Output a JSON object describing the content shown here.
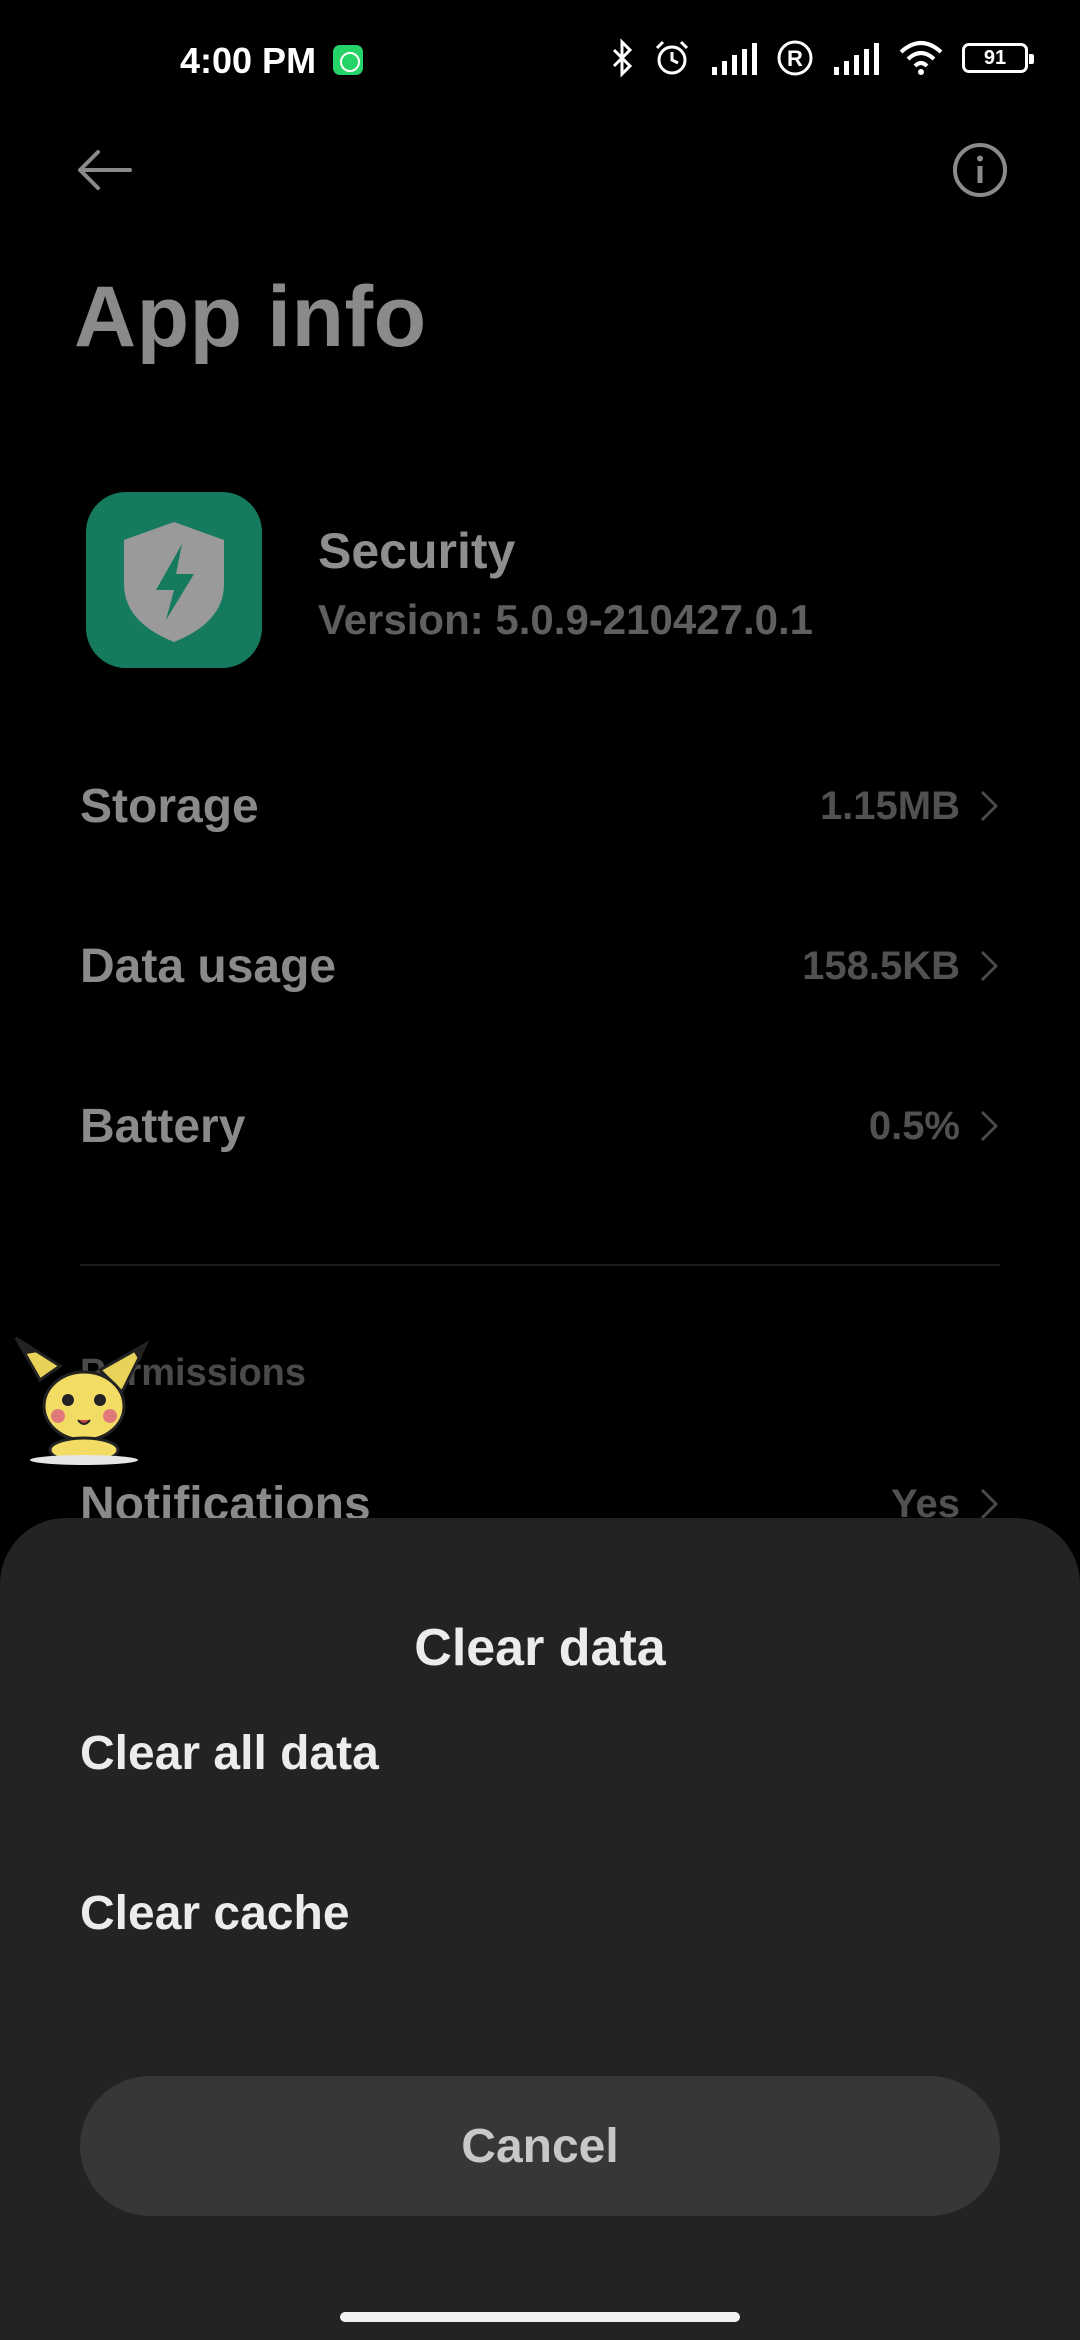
{
  "status_bar": {
    "time": "4:00 PM",
    "battery_level": "91",
    "icons": [
      "whatsapp-icon",
      "bluetooth-icon",
      "alarm-icon",
      "signal-icon",
      "roaming-icon",
      "signal-icon",
      "wifi-icon",
      "battery-icon"
    ]
  },
  "header": {
    "title": "App info",
    "back_icon": "back-arrow-icon",
    "info_icon": "info-icon"
  },
  "app": {
    "name": "Security",
    "version": "Version: 5.0.9-210427.0.1",
    "icon": "shield-lightning-icon",
    "icon_color": "#157a5e"
  },
  "rows": [
    {
      "label": "Storage",
      "value": "1.15MB"
    },
    {
      "label": "Data usage",
      "value": "158.5KB"
    },
    {
      "label": "Battery",
      "value": "0.5%"
    }
  ],
  "permissions": {
    "section_title": "Permissions",
    "notifications_label": "Notifications",
    "notifications_value": "Yes"
  },
  "sheet": {
    "title": "Clear data",
    "options": [
      {
        "label": "Clear all data"
      },
      {
        "label": "Clear cache"
      }
    ],
    "cancel_label": "Cancel"
  }
}
